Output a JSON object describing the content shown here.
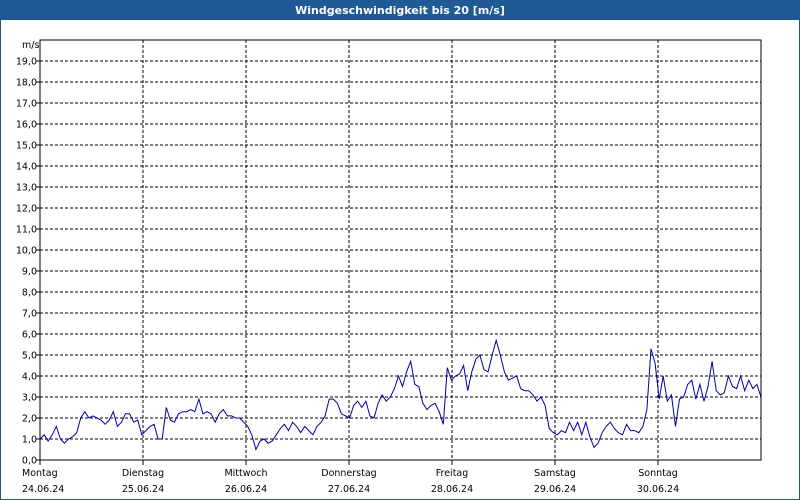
{
  "window": {
    "title": "Windgeschwindigkeit bis 20 [m/s]"
  },
  "chart_data": {
    "type": "line",
    "title": "Windgeschwindigkeit bis 20 [m/s]",
    "ylabel": "m/s",
    "xlabel": "",
    "ylim": [
      0,
      20
    ],
    "xlim": [
      0,
      7
    ],
    "grid": true,
    "line_color": "#0000a0",
    "y_ticks": [
      "0,0",
      "1,0",
      "2,0",
      "3,0",
      "4,0",
      "5,0",
      "6,0",
      "7,0",
      "8,0",
      "9,0",
      "10,0",
      "11,0",
      "12,0",
      "13,0",
      "14,0",
      "15,0",
      "16,0",
      "17,0",
      "18,0",
      "19,0"
    ],
    "days": [
      {
        "name": "Montag",
        "date": "24.06.24"
      },
      {
        "name": "Dienstag",
        "date": "25.06.24"
      },
      {
        "name": "Mittwoch",
        "date": "26.06.24"
      },
      {
        "name": "Donnerstag",
        "date": "27.06.24"
      },
      {
        "name": "Freitag",
        "date": "28.06.24"
      },
      {
        "name": "Samstag",
        "date": "29.06.24"
      },
      {
        "name": "Sonntag",
        "date": "30.06.24"
      }
    ],
    "series": [
      {
        "values": [
          1.0,
          1.2,
          0.9,
          1.2,
          1.6,
          1.0,
          0.8,
          1.0,
          1.1,
          1.3,
          2.0,
          2.3,
          2.0,
          2.1,
          2.0,
          1.9,
          1.7,
          1.9,
          2.3,
          1.6,
          1.8,
          2.2,
          2.2,
          1.8,
          1.9,
          1.2,
          1.4,
          1.6,
          1.7,
          1.0,
          1.0,
          2.5,
          1.9,
          1.8,
          2.2,
          2.3,
          2.3,
          2.4,
          2.3,
          2.9,
          2.2,
          2.3,
          2.2,
          1.8,
          2.2,
          2.4,
          2.1,
          2.1,
          2.0,
          2.0,
          1.8,
          1.6,
          1.2,
          0.5,
          0.9,
          1.0,
          0.8,
          0.9,
          1.2,
          1.5,
          1.7,
          1.4,
          1.8,
          1.6,
          1.3,
          1.6,
          1.4,
          1.2,
          1.6,
          1.8,
          2.1,
          2.9,
          2.9,
          2.7,
          2.2,
          2.1,
          2.0,
          2.6,
          2.8,
          2.5,
          2.8,
          2.1,
          2.0,
          2.7,
          3.1,
          2.8,
          3.0,
          3.4,
          4.0,
          3.5,
          4.2,
          4.7,
          3.6,
          3.5,
          2.7,
          2.4,
          2.6,
          2.7,
          2.3,
          1.7,
          4.4,
          3.8,
          4.0,
          4.1,
          4.5,
          3.3,
          4.2,
          4.8,
          5.0,
          4.3,
          4.2,
          5.0,
          5.7,
          5.0,
          4.2,
          3.8,
          3.9,
          4.0,
          3.4,
          3.3,
          3.3,
          3.1,
          2.8,
          3.0,
          2.6,
          1.5,
          1.3,
          1.2,
          1.4,
          1.3,
          1.8,
          1.4,
          1.8,
          1.2,
          1.8,
          1.1,
          0.6,
          0.8,
          1.3,
          1.6,
          1.8,
          1.5,
          1.3,
          1.2,
          1.7,
          1.4,
          1.4,
          1.3,
          1.6,
          2.4,
          5.3,
          4.6,
          2.9,
          4.0,
          2.8,
          3.1,
          1.6,
          2.9,
          3.0,
          3.6,
          3.8,
          2.9,
          3.6,
          2.8,
          3.5,
          4.7,
          3.3,
          3.1,
          3.2,
          4.0,
          3.5,
          3.4,
          4.0,
          3.3,
          3.8,
          3.4,
          3.6,
          3.0
        ]
      }
    ]
  }
}
